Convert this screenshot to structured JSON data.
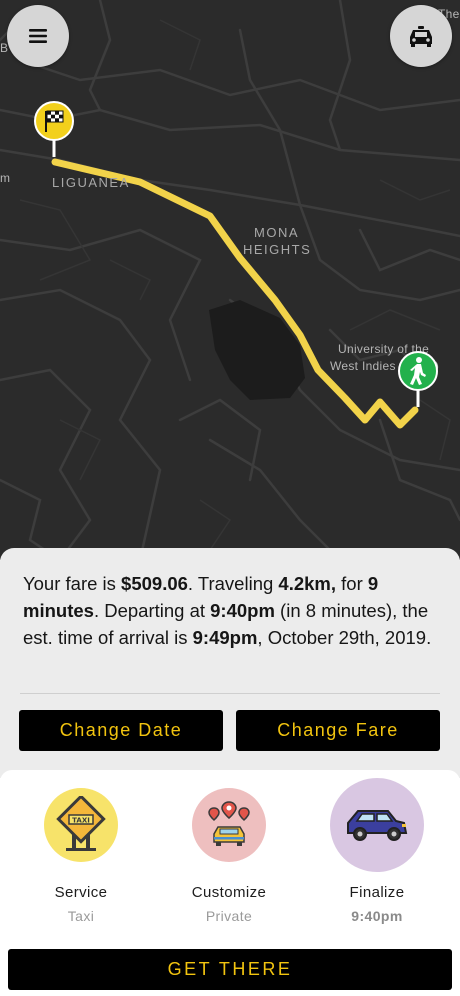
{
  "map": {
    "labels": {
      "liguanea": "LIGUANEA",
      "mona_line1": "MONA",
      "mona_line2": "HEIGHTS",
      "university_line1": "University of the",
      "university_line2": "West Indies (Mona)",
      "edge_the": "The",
      "edge_m": "m",
      "edge_b": "B"
    },
    "route_color": "#f2d34a",
    "destination_pin_color": "#f2d01c",
    "origin_pin_color": "#22b14c"
  },
  "top_buttons": {
    "menu_icon": "hamburger-icon",
    "taxi_icon": "taxi-icon"
  },
  "fare": {
    "p1": "Your fare is ",
    "amount": "$509.06",
    "p2": ". Traveling ",
    "distance": "4.2km,",
    "p3": " for ",
    "duration": "9 minutes",
    "p4": ". Departing at ",
    "depart_time": "9:40pm",
    "p5": " (in 8 minutes), the est. time of arrival is ",
    "arrival_time": "9:49pm",
    "p6": ", October 29th, 2019."
  },
  "buttons": {
    "change_date": "Change Date",
    "change_fare": "Change Fare",
    "get_there": "GET THERE"
  },
  "steps": [
    {
      "label": "Service",
      "value": "Taxi",
      "icon": "taxi-sign-icon",
      "color": "#f7e36a"
    },
    {
      "label": "Customize",
      "value": "Private",
      "icon": "car-pins-icon",
      "color": "#eebfbf"
    },
    {
      "label": "Finalize",
      "value": "9:40pm",
      "icon": "car-icon",
      "color": "#d9c7e2"
    }
  ],
  "accent_color": "#f2c40f"
}
